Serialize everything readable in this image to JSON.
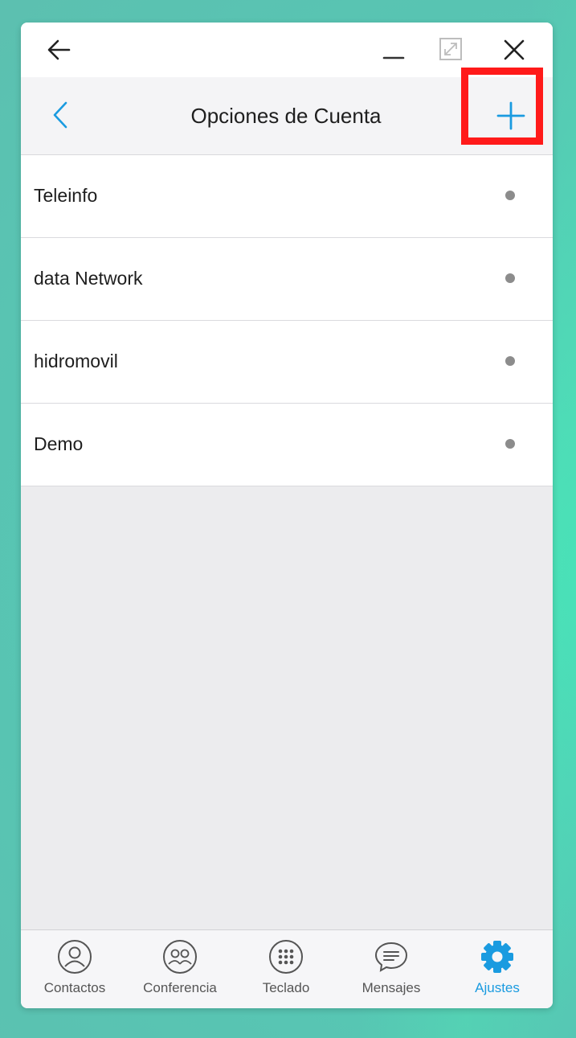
{
  "window": {
    "title": "Opciones de Cuenta"
  },
  "accounts": [
    {
      "name": "Teleinfo"
    },
    {
      "name": "data Network"
    },
    {
      "name": "hidromovil"
    },
    {
      "name": "Demo"
    }
  ],
  "tabs": [
    {
      "label": "Contactos",
      "icon": "contacts-icon",
      "active": false
    },
    {
      "label": "Conferencia",
      "icon": "conference-icon",
      "active": false
    },
    {
      "label": "Teclado",
      "icon": "keypad-icon",
      "active": false
    },
    {
      "label": "Mensajes",
      "icon": "messages-icon",
      "active": false
    },
    {
      "label": "Ajustes",
      "icon": "gear-icon",
      "active": true
    }
  ],
  "colors": {
    "accent": "#1a9be0",
    "highlight": "#ff1a1a",
    "status_dot": "#8c8c8c"
  }
}
